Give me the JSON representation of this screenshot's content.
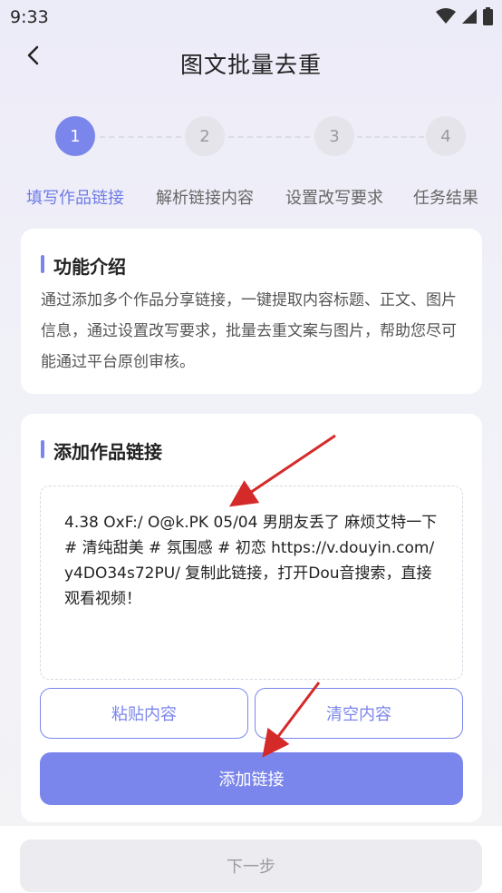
{
  "status_bar": {
    "time": "9:33"
  },
  "header": {
    "title": "图文批量去重"
  },
  "steps": [
    {
      "number": "1",
      "label": "填写作品链接",
      "active": true
    },
    {
      "number": "2",
      "label": "解析链接内容",
      "active": false
    },
    {
      "number": "3",
      "label": "设置改写要求",
      "active": false
    },
    {
      "number": "4",
      "label": "任务结果",
      "active": false
    }
  ],
  "intro_card": {
    "title": "功能介绍",
    "text": "通过添加多个作品分享链接，一键提取内容标题、正文、图片信息，通过设置改写要求，批量去重文案与图片，帮助您尽可能通过平台原创审核。"
  },
  "add_link_card": {
    "title": "添加作品链接",
    "link_text": "4.38 OxF:/ O@k.PK 05/04 男朋友丢了 麻烦艾特一下# 清纯甜美 # 氛围感 # 初恋  https://v.douyin.com/y4DO34s72PU/ 复制此链接，打开Dou音搜索，直接观看视频！",
    "paste_label": "粘贴内容",
    "clear_label": "清空内容",
    "add_label": "添加链接"
  },
  "bottom": {
    "next_label": "下一步"
  },
  "colors": {
    "accent": "#7b86ec",
    "annotation_arrow": "#d42a2a"
  },
  "icons": [
    "wifi-icon",
    "signal-icon",
    "battery-icon",
    "back-arrow-icon"
  ]
}
